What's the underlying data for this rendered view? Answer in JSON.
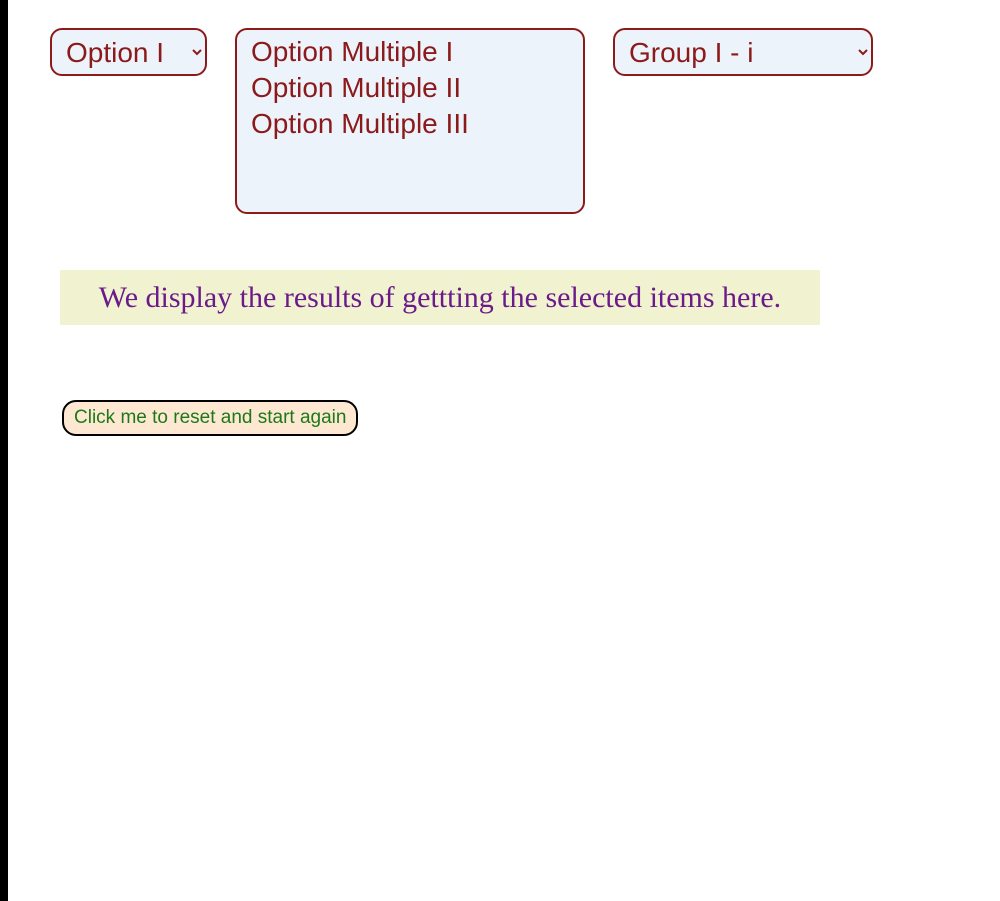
{
  "selects": {
    "single": {
      "selected": "Option I",
      "options": [
        "Option I"
      ]
    },
    "multi": {
      "options": [
        "Option Multiple I",
        "Option Multiple II",
        "Option Multiple III"
      ]
    },
    "group": {
      "selected": "Group I - i",
      "options": [
        "Group I - i"
      ]
    }
  },
  "results_text": "We display the results of gettting the selected items here.",
  "reset_button_label": "Click me to reset and start again"
}
